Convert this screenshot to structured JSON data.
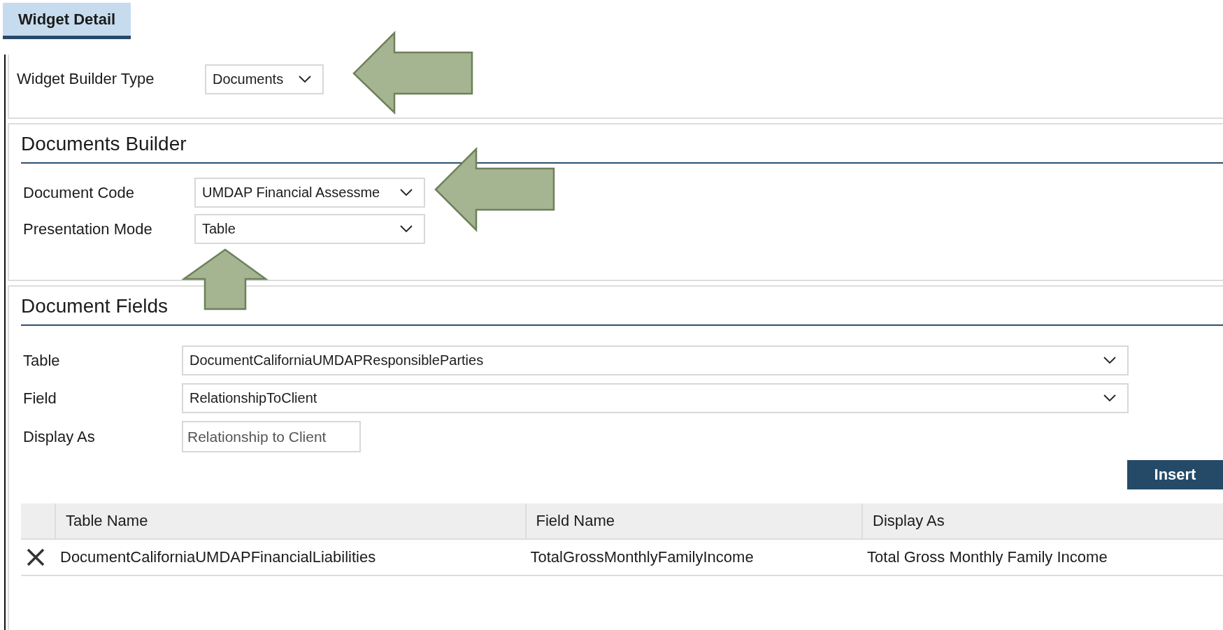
{
  "tab": {
    "label": "Widget Detail",
    "selected": true
  },
  "widget_builder": {
    "label": "Widget Builder Type",
    "value": "Documents"
  },
  "documents_builder": {
    "title": "Documents Builder",
    "fields": [
      {
        "label": "Document Code",
        "value": "UMDAP Financial Assessme"
      },
      {
        "label": "Presentation Mode",
        "value": "Table"
      }
    ]
  },
  "document_fields": {
    "title": "Document Fields",
    "fields": [
      {
        "kind": "select",
        "label": "Table",
        "value": "DocumentCaliforniaUMDAPResponsibleParties"
      },
      {
        "kind": "select",
        "label": "Field",
        "value": "RelationshipToClient"
      },
      {
        "kind": "input",
        "label": "Display As",
        "value": "Relationship to Client"
      }
    ],
    "insert_button": "Insert",
    "table": {
      "columns": [
        "Table Name",
        "Field Name",
        "Display As"
      ],
      "rows": [
        {
          "cells": [
            "DocumentCaliforniaUMDAPFinancialLiabilities",
            "TotalGrossMonthlyFamilyIncome",
            "Total Gross Monthly Family Income"
          ]
        }
      ]
    }
  }
}
